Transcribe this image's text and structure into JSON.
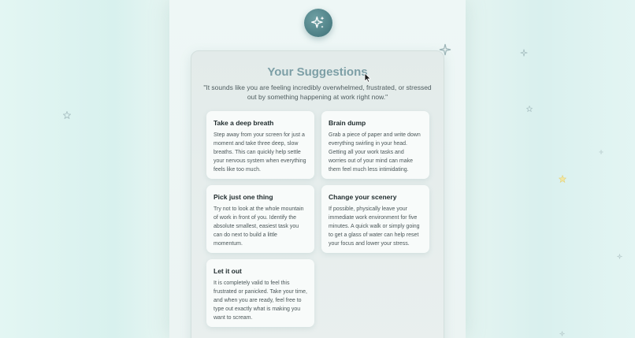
{
  "header": {
    "logo_icon": "sparkles-icon"
  },
  "suggestions": {
    "title": "Your Suggestions",
    "quote": "\"It sounds like you are feeling incredibly overwhelmed, frustrated, or stressed out by something happening at work right now.\"",
    "cards": [
      {
        "title": "Take a deep breath",
        "body": "Step away from your screen for just a moment and take three deep, slow breaths. This can quickly help settle your nervous system when everything feels like too much."
      },
      {
        "title": "Brain dump",
        "body": "Grab a piece of paper and write down everything swirling in your head. Getting all your work tasks and worries out of your mind can make them feel much less intimidating."
      },
      {
        "title": "Pick just one thing",
        "body": "Try not to look at the whole mountain of work in front of you. Identify the absolute smallest, easiest task you can do next to build a little momentum."
      },
      {
        "title": "Change your scenery",
        "body": "If possible, physically leave your immediate work environment for five minutes. A quick walk or simply going to get a glass of water can help reset your focus and lower your stress."
      },
      {
        "title": "Let it out",
        "body": "It is completely valid to feel this frustrated or panicked. Take your time, and when you are ready, feel free to type out exactly what is making you want to scream."
      }
    ]
  },
  "colors": {
    "accent": "#4d7f85",
    "title": "#7d9fa6",
    "background": "#e3f6f3"
  }
}
